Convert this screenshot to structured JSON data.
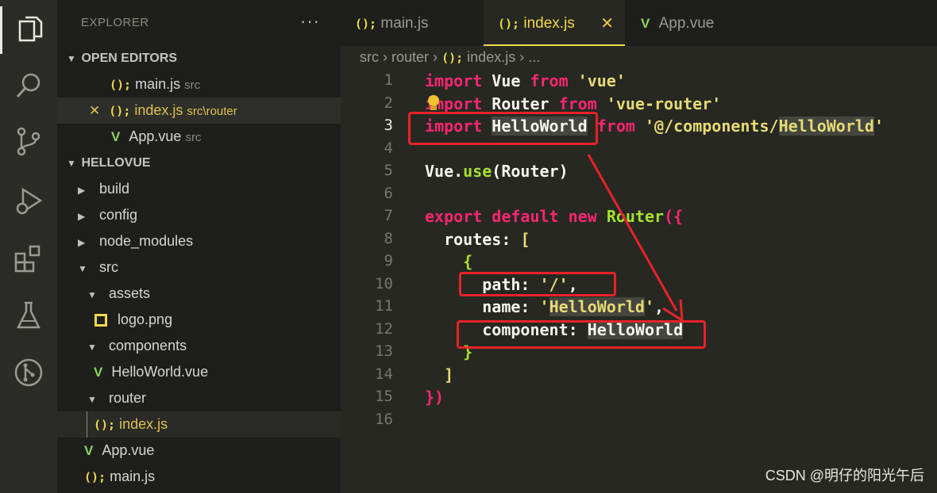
{
  "sidebar": {
    "title": "EXPLORER",
    "more": "···",
    "open_editors": {
      "label": "OPEN EDITORS",
      "files": [
        {
          "name": "main.js",
          "path": "src",
          "icon": "js-icon"
        },
        {
          "name": "index.js",
          "path": "src\\router",
          "icon": "js-icon",
          "close": "✕"
        },
        {
          "name": "App.vue",
          "path": "src",
          "icon": "vue-icon"
        }
      ]
    },
    "project": {
      "label": "HELLOVUE",
      "items": [
        {
          "name": "build"
        },
        {
          "name": "config"
        },
        {
          "name": "node_modules"
        },
        {
          "name": "src"
        },
        {
          "name": "assets"
        },
        {
          "name": "logo.png"
        },
        {
          "name": "components"
        },
        {
          "name": "HelloWorld.vue"
        },
        {
          "name": "router"
        },
        {
          "name": "index.js"
        },
        {
          "name": "App.vue"
        },
        {
          "name": "main.js"
        }
      ]
    }
  },
  "tabs": [
    {
      "label": "main.js",
      "icon": "js-icon"
    },
    {
      "label": "index.js",
      "icon": "js-icon",
      "close": "✕"
    },
    {
      "label": "App.vue",
      "icon": "vue-icon"
    }
  ],
  "breadcrumb": {
    "root": "src",
    "folder": "router",
    "file": "index.js",
    "more": "..."
  },
  "editor": {
    "line_numbers": [
      "1",
      "2",
      "3",
      "4",
      "5",
      "6",
      "7",
      "8",
      "9",
      "10",
      "11",
      "12",
      "13",
      "14",
      "15",
      "16"
    ],
    "current_line": "3",
    "code": {
      "l1": {
        "kw1": "import",
        "id": " Vue ",
        "kw2": "from",
        "str": " 'vue'"
      },
      "l2": {
        "kw1": "import",
        "id": " Router ",
        "kw2": "from",
        "str": " 'vue-router'"
      },
      "l3": {
        "kw1": "import",
        "id": "HelloWorld",
        "kw2": "from",
        "str1": "'@/components/",
        "str2": "HelloWorld",
        "str3": "'"
      },
      "l5": {
        "obj": "Vue",
        "dot": ".",
        "fn": "use",
        "arg": "(Router)"
      },
      "l7": {
        "kw1": "export",
        "kw2": "default",
        "kw3": "new",
        "cls": "Router",
        "brace": "({"
      },
      "l8": {
        "key": "routes",
        "colon": ": ",
        "br": "["
      },
      "l9": {
        "br": "{"
      },
      "l10": {
        "key": "path",
        "colon": ": ",
        "str": "'/'",
        "comma": ","
      },
      "l11": {
        "key": "name",
        "colon": ": ",
        "q1": "'",
        "str": "HelloWorld",
        "q2": "'",
        "comma": ","
      },
      "l12": {
        "key": "component",
        "colon": ": ",
        "val": "HelloWorld"
      },
      "l13": {
        "br": "}"
      },
      "l14": {
        "br": "]"
      },
      "l15": {
        "br": "})"
      }
    }
  },
  "watermark": "CSDN @明仔的阳光午后",
  "colors": {
    "keyword": "#f92672",
    "string": "#e6db74",
    "function": "#a6e22e",
    "js_icon": "#f2d84b",
    "vue_icon": "#8dd35f",
    "annotation": "#e8222a"
  }
}
